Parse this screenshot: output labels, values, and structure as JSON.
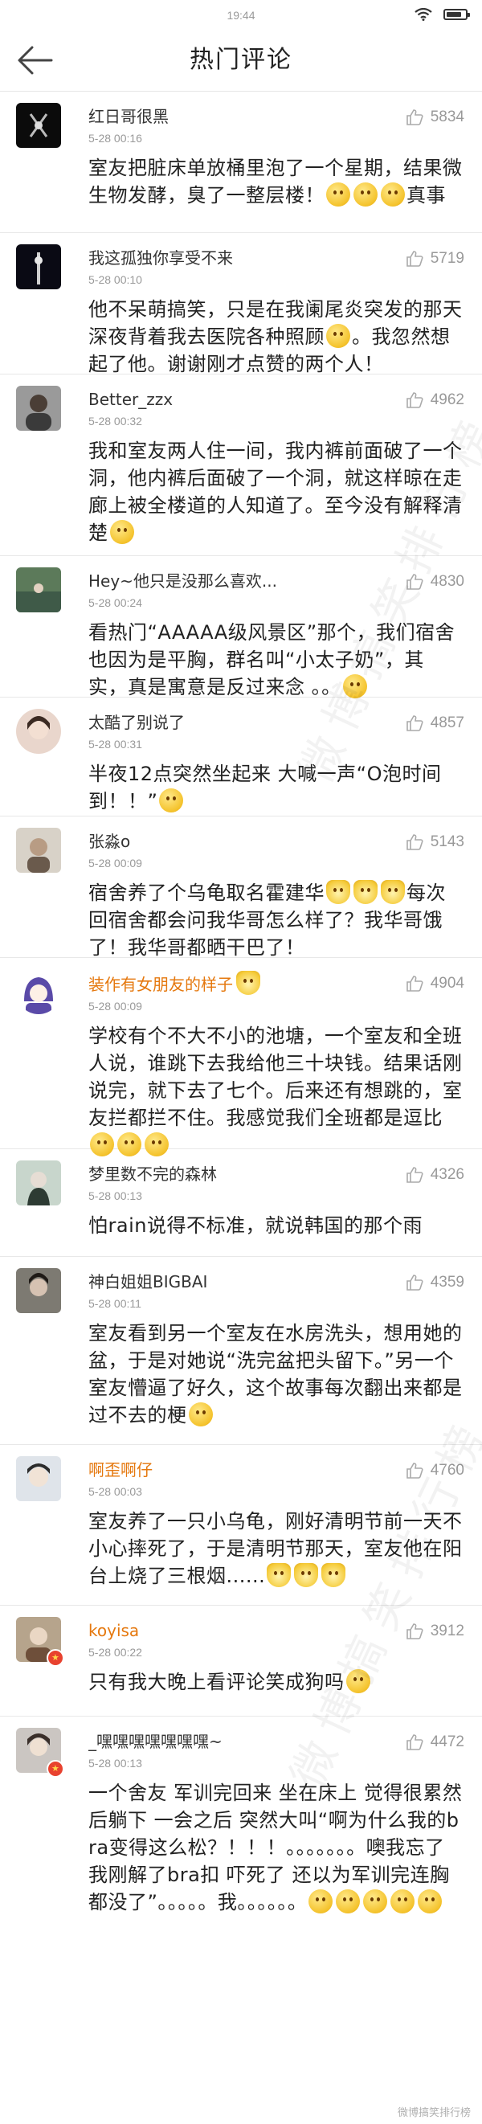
{
  "status_bar": {
    "time": "19:44"
  },
  "header": {
    "title": "热门评论"
  },
  "comments": [
    {
      "user": "红日哥很黑",
      "time": "5-28 00:16",
      "likes": "5834",
      "text": "室友把脏床单放桶里泡了一个星期，结果微生物发酵，臭了一整层楼！",
      "text_after": "真事"
    },
    {
      "user": "我这孤独你享受不来",
      "time": "5-28 00:10",
      "likes": "5719",
      "text": "他不呆萌搞笑，只是在我阑尾炎突发的那天深夜背着我去医院各种照顾",
      "text_after": "。我忽然想起了他。谢谢刚才点赞的两个人！"
    },
    {
      "user": "Better_zzx",
      "time": "5-28 00:32",
      "likes": "4962",
      "text": "我和室友两人住一间，我内裤前面破了一个洞，他内裤后面破了一个洞，就这样晾在走廊上被全楼道的人知道了。至今没有解释清楚",
      "text_after": ""
    },
    {
      "user": "Hey~他只是没那么喜欢...",
      "time": "5-28 00:24",
      "likes": "4830",
      "text": "看热门“AAAAA级风景区”那个，我们宿舍也因为是平胸，群名叫“小太子奶”，其实，真是寓意是反过来念 。。",
      "text_after": ""
    },
    {
      "user": "太酷了别说了",
      "time": "5-28 00:31",
      "likes": "4857",
      "text": "半夜12点突然坐起来 大喊一声“O泡时间到！！”",
      "text_after": ""
    },
    {
      "user": "张淼o",
      "time": "5-28 00:09",
      "likes": "5143",
      "text": "宿舍养了个乌龟取名霍建华",
      "text_after": "每次回宿舍都会问我华哥怎么样了？我华哥饿了！我华哥都晒干巴了！"
    },
    {
      "user": "装作有女朋友的样子",
      "time": "5-28 00:09",
      "likes": "4904",
      "text": "学校有个不大不小的池塘，一个室友和全班人说，谁跳下去我给他三十块钱。结果话刚说完，就下去了七个。后来还有想跳的，室友拦都拦不住。我感觉我们全班都是逗比",
      "text_after": ""
    },
    {
      "user": "梦里数不完的森林",
      "time": "5-28 00:13",
      "likes": "4326",
      "text": "怕rain说得不标准，就说韩国的那个雨",
      "text_after": ""
    },
    {
      "user": "神白姐姐BIGBAI",
      "time": "5-28 00:11",
      "likes": "4359",
      "text": "室友看到另一个室友在水房洗头，想用她的盆，于是对她说“洗完盆把头留下。”另一个室友懵逼了好久，这个故事每次翻出来都是过不去的梗",
      "text_after": ""
    },
    {
      "user": "啊歪啊仔",
      "time": "5-28 00:03",
      "likes": "4760",
      "text": "室友养了一只小乌龟，刚好清明节前一天不小心摔死了，于是清明节那天，室友他在阳台上烧了三根烟......",
      "text_after": ""
    },
    {
      "user": "koyisa",
      "time": "5-28 00:22",
      "likes": "3912",
      "text": "只有我大晚上看评论笑成狗吗",
      "text_after": ""
    },
    {
      "user": "_嘿嘿嘿嘿嘿嘿嘿~",
      "time": "5-28 00:13",
      "likes": "4472",
      "text": "一个舍友 军训完回来 坐在床上 觉得很累然后躺下 一会之后 突然大叫“啊为什么我的bra变得这么松？！！！。。。。。。。噢我忘了我刚解了bra扣 吓死了 还以为军训完连胸都没了”。。。。。我。。。。。。",
      "text_after": ""
    }
  ],
  "watermark": {
    "text": "微博搞笑排行榜"
  }
}
